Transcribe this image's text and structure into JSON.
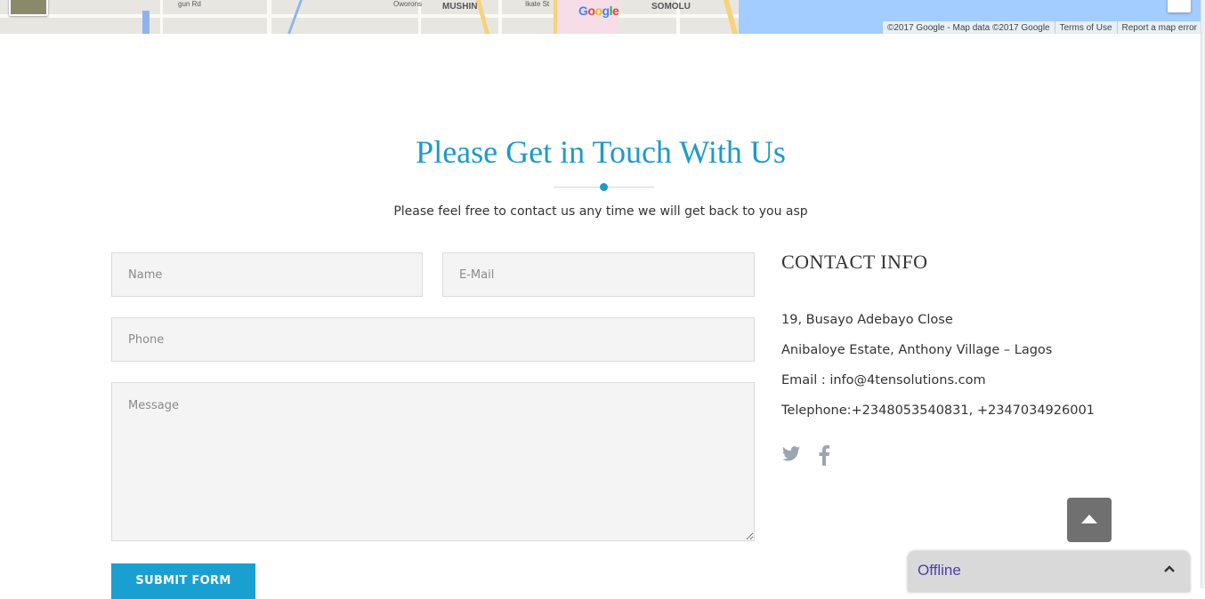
{
  "map": {
    "labels": [
      "MUSHIN",
      "SOMOLU",
      "Oworons",
      "gun Rd",
      "Ikate St"
    ],
    "logo": "Google",
    "attribution": "©2017 Google - Map data ©2017 Google",
    "terms_label": "Terms of Use",
    "report_label": "Report a map error"
  },
  "heading": {
    "title": "Please Get in Touch With Us",
    "subtitle": "Please feel free to contact us any time we will get back to you asp"
  },
  "form": {
    "name_placeholder": "Name",
    "email_placeholder": "E-Mail",
    "phone_placeholder": "Phone",
    "message_placeholder": "Message",
    "submit_label": "SUBMIT FORM"
  },
  "contact": {
    "title": "CONTACT INFO",
    "address_line1": "19, Busayo Adebayo Close",
    "address_line2": "Anibaloye Estate, Anthony Village – Lagos",
    "email": "Email : info@4tensolutions.com",
    "telephone": "Telephone:+2348053540831, +2347034926001",
    "social_icons": [
      "twitter-icon",
      "facebook-icon"
    ]
  },
  "chat": {
    "status": "Offline"
  },
  "colors": {
    "accent": "#1e9ac8",
    "button": "#1aa0d0",
    "social_icon": "#9aa6b2",
    "chat_text": "#4a3fb0"
  }
}
